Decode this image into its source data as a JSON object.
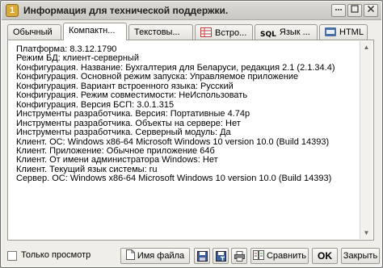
{
  "window": {
    "title": "Информация для технической поддержки."
  },
  "tabs": [
    {
      "label": "Обычный"
    },
    {
      "label": "Компактн..."
    },
    {
      "label": "Текстовы..."
    },
    {
      "label": "Встро..."
    },
    {
      "label": "Язык ..."
    },
    {
      "label": "HTML"
    }
  ],
  "tab_icon_texts": {
    "sql": "SQL"
  },
  "info_lines": [
    "Платформа: 8.3.12.1790",
    "Режим БД: клиент-серверный",
    "Конфигурация. Название: Бухгалтерия для Беларуси, редакция 2.1 (2.1.34.4)",
    "Конфигурация. Основной режим запуска: Управляемое приложение",
    "Конфигурация. Вариант встроенного языка: Русский",
    "Конфигурация. Режим совместимости: НеИспользовать",
    "Конфигурация. Версия БСП: 3.0.1.315",
    "Инструменты разработчика. Версия: Портативные 4.74р",
    "Инструменты разработчика. Объекты на сервере: Нет",
    "Инструменты разработчика. Серверный модуль: Да",
    "Клиент. ОС: Windows x86-64 Microsoft Windows 10 version 10.0  (Build 14393)",
    "Клиент. Приложение: Обычное приложение 64б",
    "Клиент. От имени администратора Windows: Нет",
    "Клиент. Текущий язык системы: ru",
    "Сервер. ОС: Windows x86-64 Microsoft Windows 10 version 10.0  (Build 14393)"
  ],
  "bottom": {
    "checkbox_label": "Только просмотр",
    "checkbox_checked": false,
    "filename_button": "Имя файла",
    "compare_button": "Сравнить",
    "ok_button": "OK",
    "close_button": "Закрыть"
  },
  "colors": {
    "app_icon": "#d9a93a",
    "html_badge": "#4a6fa5"
  }
}
